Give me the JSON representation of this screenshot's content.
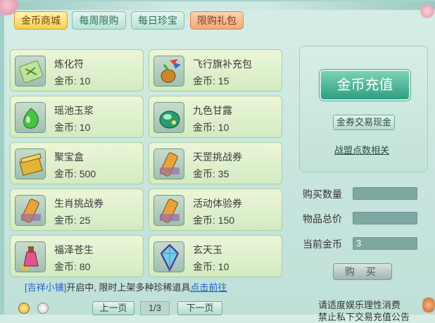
{
  "tabs": [
    {
      "label": "金币商城",
      "state": "active"
    },
    {
      "label": "每周限购",
      "state": "inactive"
    },
    {
      "label": "每日珍宝",
      "state": "inactive"
    },
    {
      "label": "限购礼包",
      "state": "highlight"
    }
  ],
  "items": [
    {
      "name": "炼化符",
      "price": "金币: 10",
      "icon": "talisman-icon"
    },
    {
      "name": "飞行旗补充包",
      "price": "金币: 15",
      "icon": "flag-pack-icon"
    },
    {
      "name": "瑶池玉浆",
      "price": "金币: 10",
      "icon": "jade-elixir-icon"
    },
    {
      "name": "九色甘露",
      "price": "金币: 10",
      "icon": "dew-jade-icon"
    },
    {
      "name": "聚宝盒",
      "price": "金币: 500",
      "icon": "treasure-box-icon"
    },
    {
      "name": "天罡挑战券",
      "price": "金币: 35",
      "icon": "scroll-ticket-icon"
    },
    {
      "name": "生肖挑战券",
      "price": "金币: 25",
      "icon": "scroll-ticket-icon"
    },
    {
      "name": "活动体验券",
      "price": "金币: 150",
      "icon": "scroll-ticket-icon"
    },
    {
      "name": "福泽苍生",
      "price": "金币: 80",
      "icon": "potion-bottle-icon"
    },
    {
      "name": "玄天玉",
      "price": "金币: 10",
      "icon": "crystal-jade-icon"
    }
  ],
  "right_panel": {
    "recharge_label": "金币充值",
    "exchange_label": "金券交易现金",
    "alliance_link": "战盟点数相关"
  },
  "purchase": {
    "qty_label": "购买数量",
    "qty_value": "",
    "total_label": "物品总价",
    "total_value": "",
    "gold_label": "当前金币",
    "gold_value": "3",
    "buy_label": "购 买"
  },
  "notice": {
    "tag": "[吉祥小铺]",
    "text": "开启中, 限时上架多种珍稀道具",
    "link": "点击前往"
  },
  "pagination": {
    "prev": "上一页",
    "page": "1/3",
    "next": "下一页"
  },
  "footer_warning": {
    "line1": "请适度娱乐理性消费",
    "line2": "禁止私下交易充值公告"
  },
  "colors": {
    "accent": "#2f9d83",
    "link": "#1f62c8",
    "active_tab": "#f6cf4f"
  }
}
